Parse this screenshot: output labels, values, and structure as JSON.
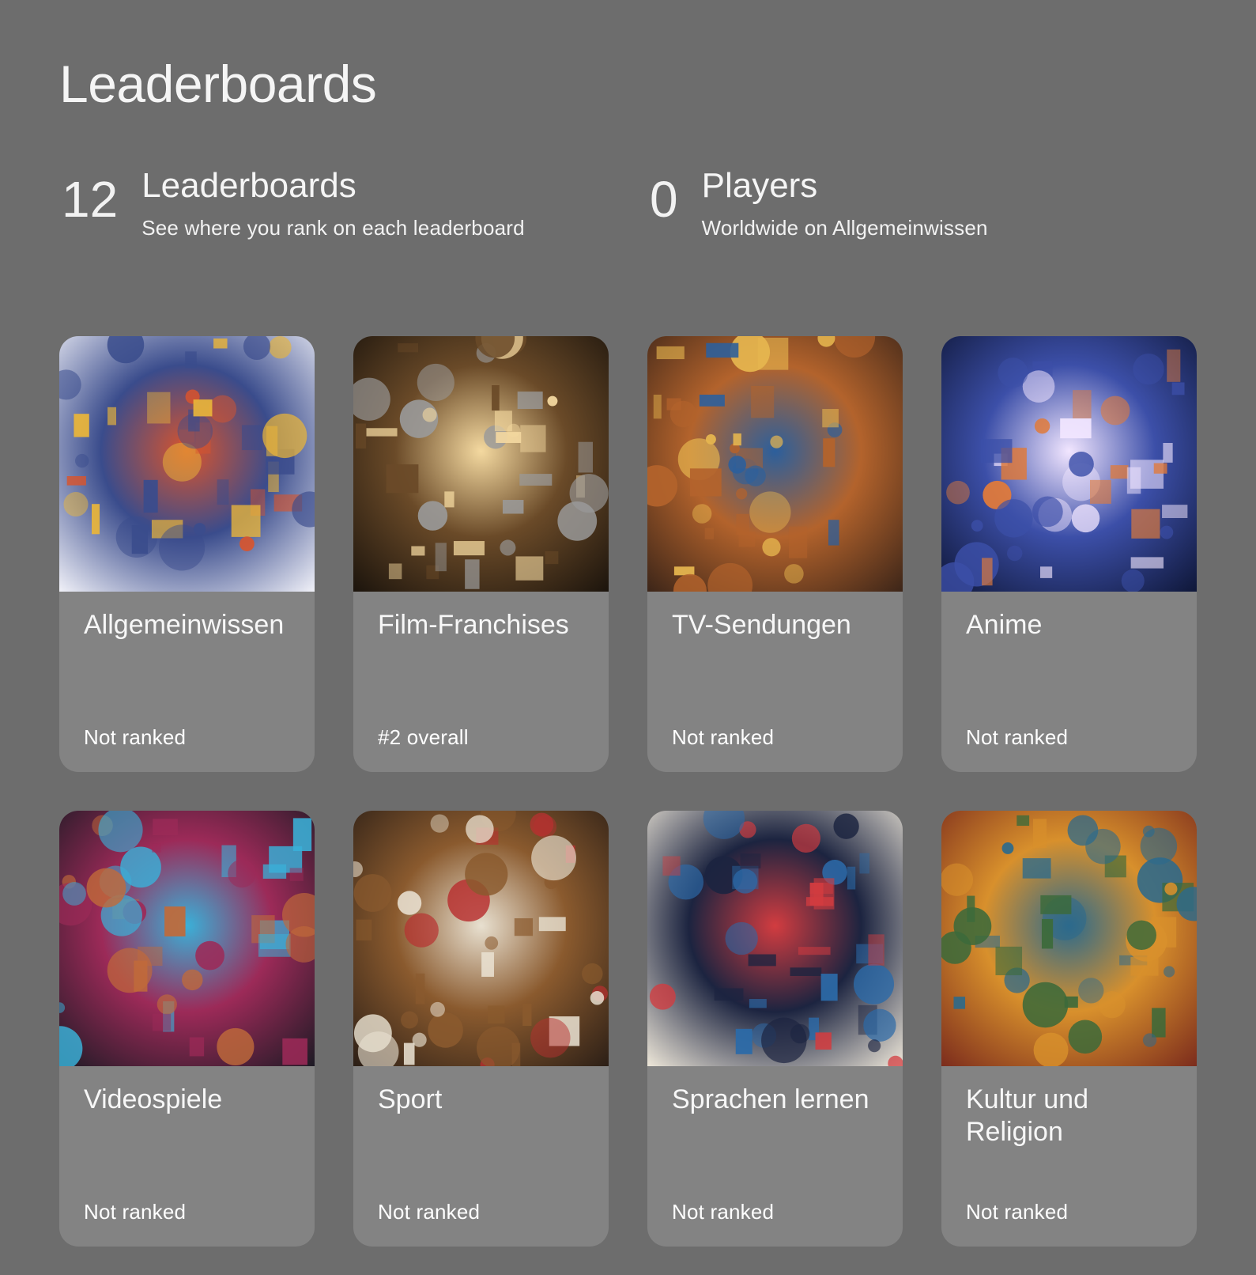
{
  "page": {
    "title": "Leaderboards"
  },
  "stats": {
    "leaderboards": {
      "value": "12",
      "label": "Leaderboards",
      "sub": "See where you rank on each leaderboard"
    },
    "players": {
      "value": "0",
      "label": "Players",
      "sub": "Worldwide on Allgemeinwissen"
    }
  },
  "cards": [
    {
      "title": "Allgemeinwissen",
      "rank": "Not ranked",
      "image": "general-knowledge-collage-image",
      "colors": [
        "#f4f4fa",
        "#3a4c8c",
        "#d9542c",
        "#e9b53a"
      ]
    },
    {
      "title": "Film-Franchises",
      "rank": "#2 overall",
      "image": "film-reels-clapperboard-image",
      "colors": [
        "#1a130c",
        "#6a4a28",
        "#f4d9a0",
        "#9a9a9a"
      ]
    },
    {
      "title": "TV-Sendungen",
      "rank": "Not ranked",
      "image": "tv-living-room-image",
      "colors": [
        "#3a2418",
        "#b3632c",
        "#2c5f9c",
        "#e6b64f"
      ]
    },
    {
      "title": "Anime",
      "rank": "Not ranked",
      "image": "anime-characters-image",
      "colors": [
        "#0e1636",
        "#3c4fa8",
        "#f2e6ff",
        "#e07a3a"
      ]
    },
    {
      "title": "Videospiele",
      "rank": "Not ranked",
      "image": "gamer-setup-image",
      "colors": [
        "#1b1a24",
        "#9c2a58",
        "#3ab0d8",
        "#c06a3a"
      ]
    },
    {
      "title": "Sport",
      "rank": "Not ranked",
      "image": "sports-equipment-stadium-image",
      "colors": [
        "#2a1e16",
        "#8a5a2e",
        "#e8e0d0",
        "#b83030"
      ]
    },
    {
      "title": "Sprachen lernen",
      "rank": "Not ranked",
      "image": "language-globe-image",
      "colors": [
        "#f2ebdc",
        "#1c2440",
        "#d23c40",
        "#2c6aa8"
      ]
    },
    {
      "title": "Kultur und Religion",
      "rank": "Not ranked",
      "image": "culture-religion-mosaic-image",
      "colors": [
        "#7a2a1c",
        "#d8902c",
        "#2c6a8c",
        "#3c6a3a"
      ]
    }
  ]
}
